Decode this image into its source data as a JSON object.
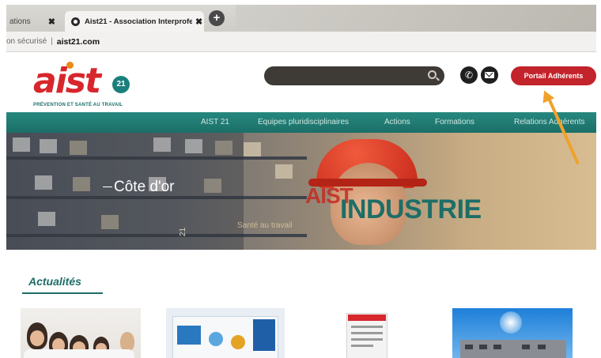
{
  "browser": {
    "tabs": [
      {
        "label": "ations",
        "close": "✖"
      },
      {
        "label": "Aist21 - Association Interprofes:",
        "close": "✖"
      }
    ],
    "new_tab": "+",
    "address": {
      "security": "on sécurisé",
      "separator": "|",
      "url": "aist21.com"
    }
  },
  "site": {
    "logo": {
      "text": "aist",
      "badge": "21",
      "tagline": "PRÉVENTION ET SANTÉ AU TRAVAIL"
    },
    "search": {
      "placeholder": ""
    },
    "member_button": "Portail Adhérents",
    "nav": [
      "AIST 21",
      "Equipes pluridisciplinaires",
      "Actions",
      "Formations",
      "Relations Adhérents"
    ],
    "banner": {
      "location": "Côte d'or",
      "brand_overlay": "AIST",
      "title": "INDUSTRIE",
      "subtitle": "Santé au travail",
      "vertical_label": "21"
    },
    "news": {
      "title": "Actualités"
    }
  },
  "colors": {
    "brand_red": "#c3232b",
    "brand_teal": "#1d6e67",
    "annotation_arrow": "#f0a12a"
  }
}
